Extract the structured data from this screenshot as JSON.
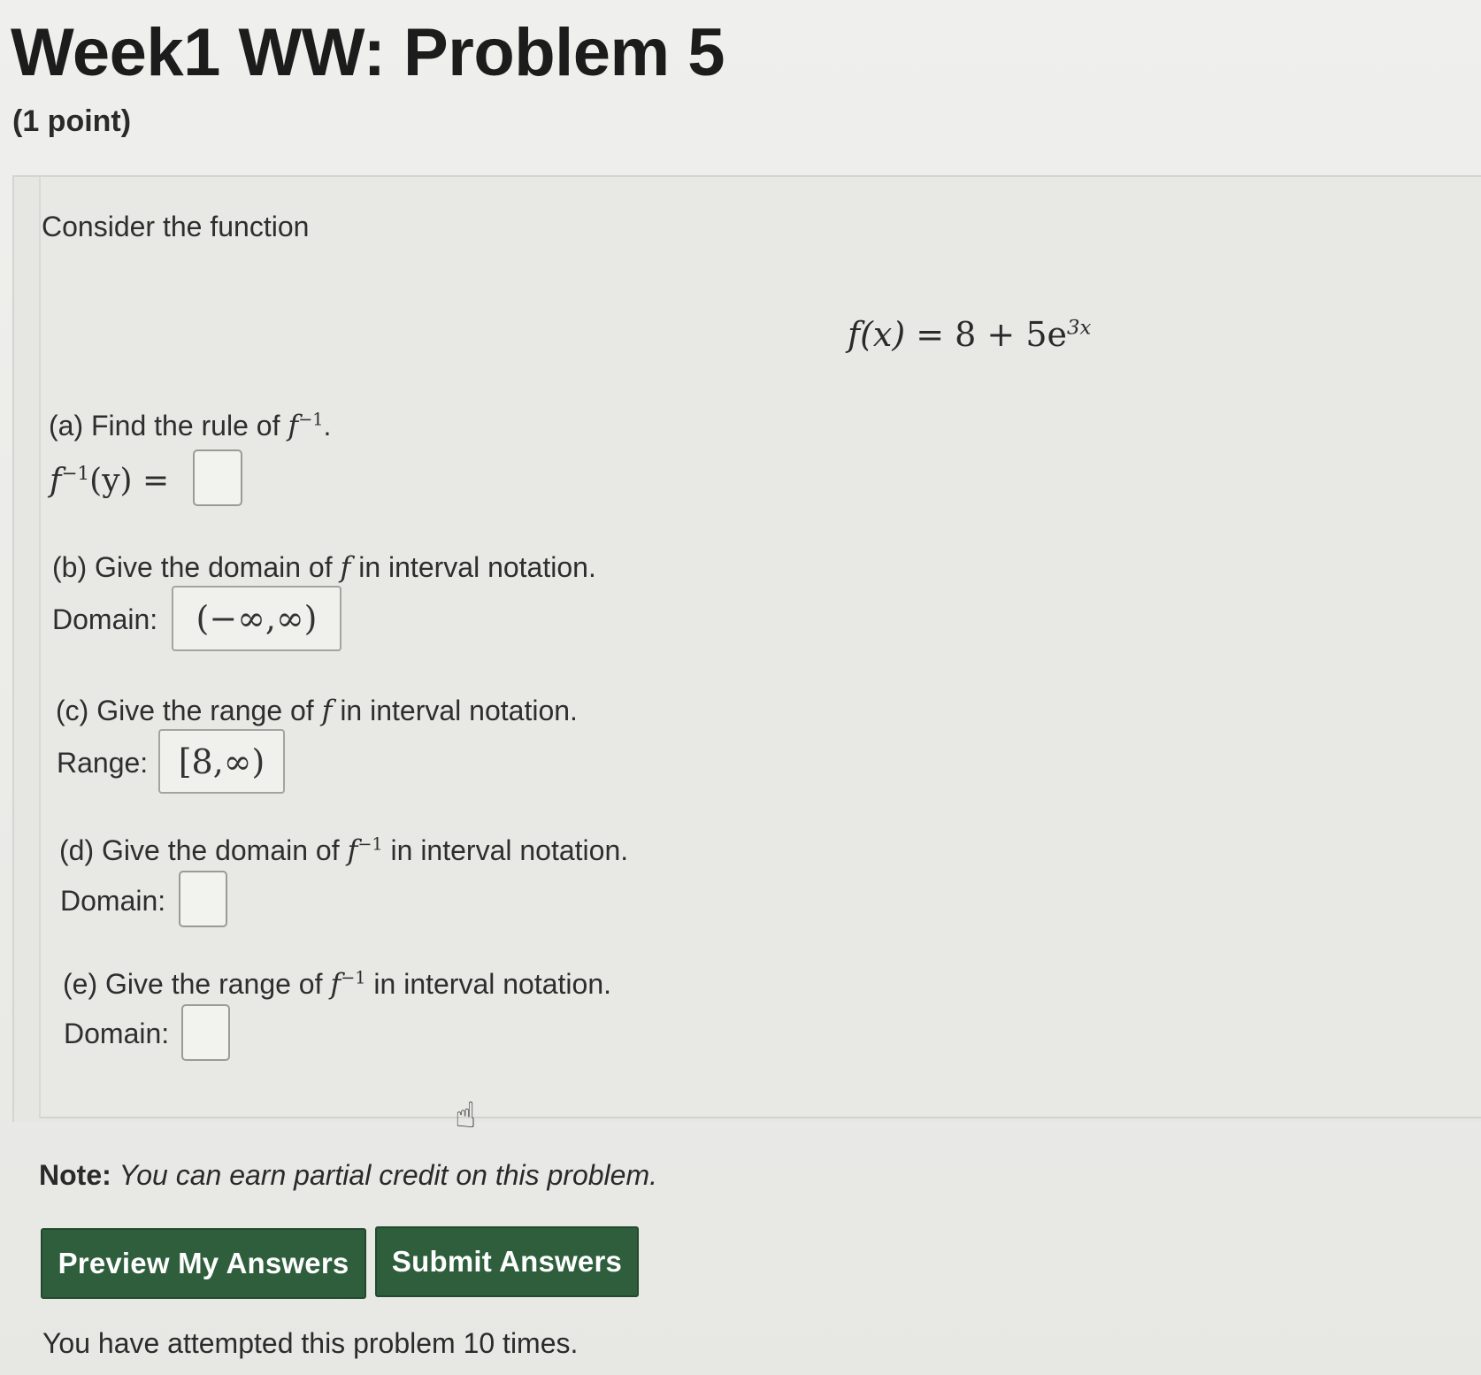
{
  "header": {
    "title": "Week1 WW: Problem 5",
    "points": "(1 point)"
  },
  "problem": {
    "intro": "Consider the function",
    "formula": {
      "lhs": "f(x)",
      "eq": " = 8 + 5e",
      "exp": "3x"
    },
    "parts": [
      {
        "prompt_pre": "(a) Find the rule of ",
        "prompt_math": "f",
        "prompt_sup": "−1",
        "prompt_post": ".",
        "label_math": "f",
        "label_sup": "−1",
        "label_rest": "(y) =",
        "value": ""
      },
      {
        "prompt_pre": "(b) Give the domain of ",
        "prompt_math": "f",
        "prompt_post": " in interval notation.",
        "label": "Domain:",
        "value": "(−∞,∞)"
      },
      {
        "prompt_pre": "(c) Give the range of ",
        "prompt_math": "f",
        "prompt_post": " in interval notation.",
        "label": "Range:",
        "value": "[8,∞)"
      },
      {
        "prompt_pre": "(d) Give the domain of ",
        "prompt_math": "f",
        "prompt_sup": "−1",
        "prompt_post": " in interval notation.",
        "label": "Domain:",
        "value": ""
      },
      {
        "prompt_pre": "(e) Give the range of ",
        "prompt_math": "f",
        "prompt_sup": "−1",
        "prompt_post": " in interval notation.",
        "label": "Domain:",
        "value": ""
      }
    ]
  },
  "note": {
    "label": "Note:",
    "text": "You can earn partial credit on this problem."
  },
  "buttons": {
    "preview": "Preview My Answers",
    "submit": "Submit Answers"
  },
  "status": {
    "attempts": "You have attempted this problem 10 times."
  },
  "colors": {
    "button_bg": "#2e5e3c",
    "button_text": "#ffffff"
  }
}
